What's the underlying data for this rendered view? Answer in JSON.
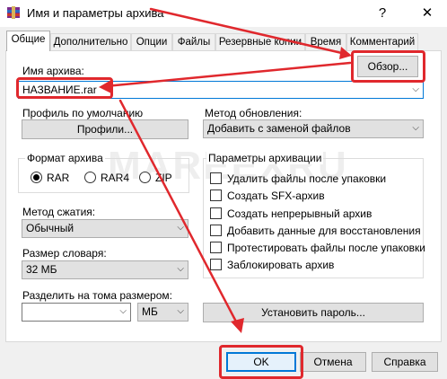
{
  "window": {
    "title": "Имя и параметры архива",
    "help": "?",
    "close": "✕"
  },
  "tabs": [
    {
      "label": "Общие"
    },
    {
      "label": "Дополнительно"
    },
    {
      "label": "Опции"
    },
    {
      "label": "Файлы"
    },
    {
      "label": "Резервные копии"
    },
    {
      "label": "Время"
    },
    {
      "label": "Комментарий"
    }
  ],
  "archive_name": {
    "label": "Имя архива:",
    "value": "НАЗВАНИЕ.rar",
    "browse_button": "Обзор..."
  },
  "profile": {
    "label": "Профиль по умолчанию",
    "button": "Профили..."
  },
  "update_method": {
    "label": "Метод обновления:",
    "value": "Добавить с заменой файлов"
  },
  "format": {
    "label": "Формат архива",
    "options": [
      "RAR",
      "RAR4",
      "ZIP"
    ],
    "selected": "RAR"
  },
  "compression": {
    "label": "Метод сжатия:",
    "value": "Обычный"
  },
  "dictionary": {
    "label": "Размер словаря:",
    "value": "32 МБ"
  },
  "split": {
    "label": "Разделить на тома размером:",
    "size_value": "",
    "unit_value": "МБ"
  },
  "options": {
    "label": "Параметры архивации",
    "items": [
      {
        "label": "Удалить файлы после упаковки",
        "checked": false
      },
      {
        "label": "Создать SFX-архив",
        "checked": false
      },
      {
        "label": "Создать непрерывный архив",
        "checked": false
      },
      {
        "label": "Добавить данные для восстановления",
        "checked": false
      },
      {
        "label": "Протестировать файлы после упаковки",
        "checked": false
      },
      {
        "label": "Заблокировать архив",
        "checked": false
      }
    ]
  },
  "password_button": "Установить пароль...",
  "footer": {
    "ok": "OK",
    "cancel": "Отмена",
    "help": "Справка"
  },
  "watermark": "MAREEXRU",
  "colors": {
    "highlight": "#e0282d",
    "focus": "#0078d7"
  }
}
